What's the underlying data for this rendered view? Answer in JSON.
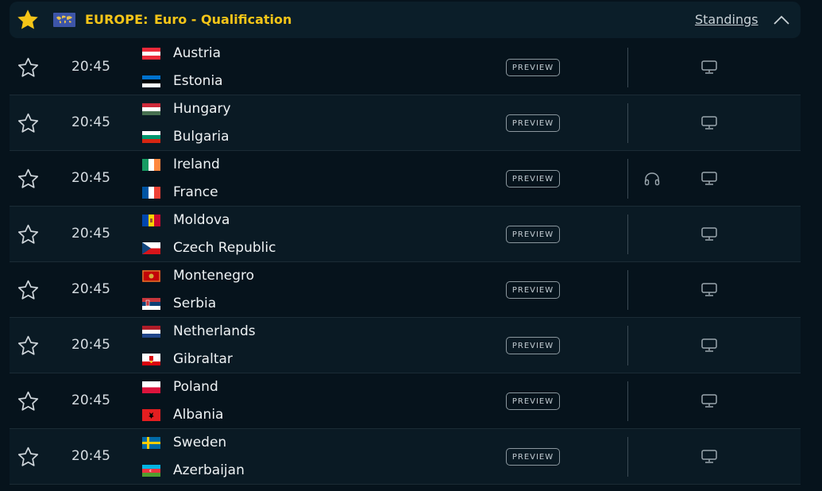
{
  "league": {
    "country": "EUROPE:",
    "name": "Euro - Qualification",
    "standings_label": "Standings",
    "accent_color": "#f5c518"
  },
  "matches": [
    {
      "time": "20:45",
      "home": "Austria",
      "away": "Estonia",
      "home_flag": "austria",
      "away_flag": "estonia",
      "preview": "PREVIEW",
      "audio": false
    },
    {
      "time": "20:45",
      "home": "Hungary",
      "away": "Bulgaria",
      "home_flag": "hungary",
      "away_flag": "bulgaria",
      "preview": "PREVIEW",
      "audio": false
    },
    {
      "time": "20:45",
      "home": "Ireland",
      "away": "France",
      "home_flag": "ireland",
      "away_flag": "france",
      "preview": "PREVIEW",
      "audio": true
    },
    {
      "time": "20:45",
      "home": "Moldova",
      "away": "Czech Republic",
      "home_flag": "moldova",
      "away_flag": "czech-republic",
      "preview": "PREVIEW",
      "audio": false
    },
    {
      "time": "20:45",
      "home": "Montenegro",
      "away": "Serbia",
      "home_flag": "montenegro",
      "away_flag": "serbia",
      "preview": "PREVIEW",
      "audio": false
    },
    {
      "time": "20:45",
      "home": "Netherlands",
      "away": "Gibraltar",
      "home_flag": "netherlands",
      "away_flag": "gibraltar",
      "preview": "PREVIEW",
      "audio": false
    },
    {
      "time": "20:45",
      "home": "Poland",
      "away": "Albania",
      "home_flag": "poland",
      "away_flag": "albania",
      "preview": "PREVIEW",
      "audio": false
    },
    {
      "time": "20:45",
      "home": "Sweden",
      "away": "Azerbaijan",
      "home_flag": "sweden",
      "away_flag": "azerbaijan",
      "preview": "PREVIEW",
      "audio": false
    }
  ]
}
